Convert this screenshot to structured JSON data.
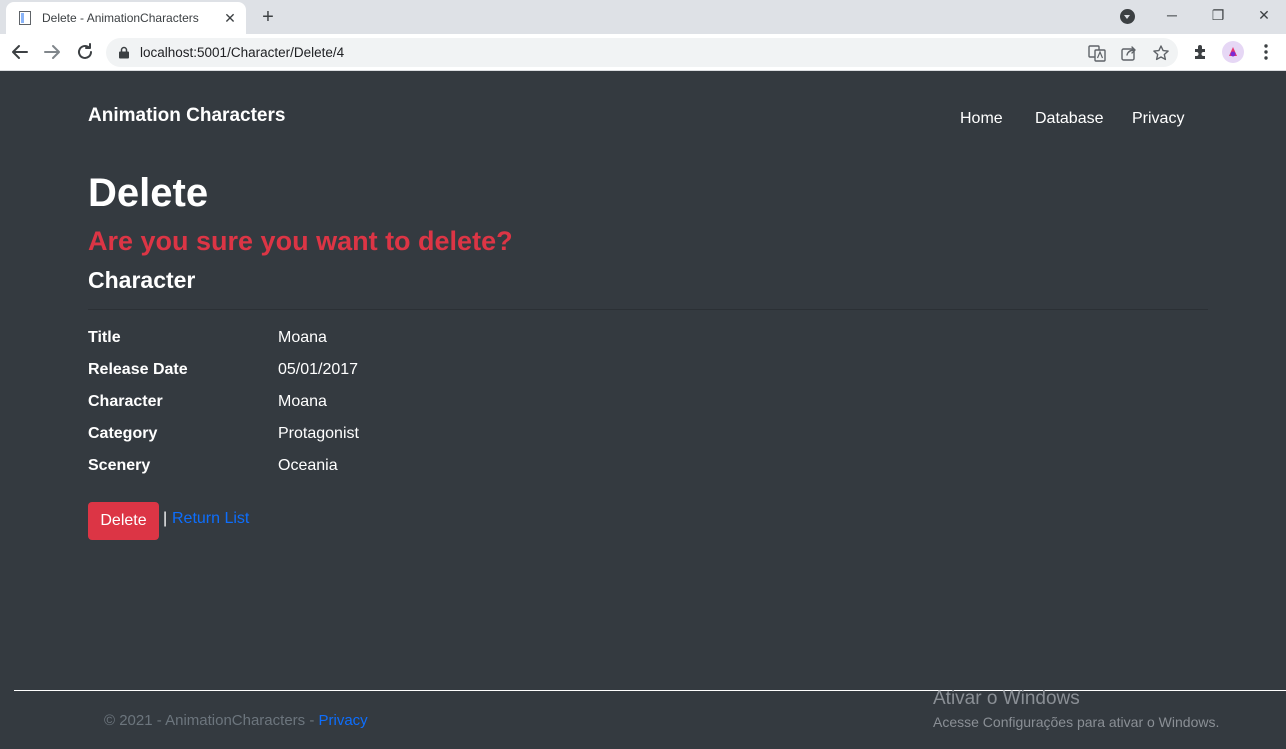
{
  "browser": {
    "tab_title": "Delete - AnimationCharacters",
    "tab_close": "✕",
    "new_tab": "+",
    "url": "localhost:5001/Character/Delete/4",
    "window_minimize": "─",
    "window_restore": "❐",
    "window_close": "✕"
  },
  "nav": {
    "brand": "Animation Characters",
    "links": [
      "Home",
      "Database",
      "Privacy"
    ]
  },
  "main": {
    "title": "Delete",
    "warning": "Are you sure you want to delete?",
    "entity": "Character",
    "details": [
      {
        "label": "Title",
        "value": "Moana"
      },
      {
        "label": "Release Date",
        "value": "05/01/2017"
      },
      {
        "label": "Character",
        "value": "Moana"
      },
      {
        "label": "Category",
        "value": "Protagonist"
      },
      {
        "label": "Scenery",
        "value": "Oceania"
      }
    ],
    "delete_button": "Delete",
    "separator": "|",
    "return_link": "Return List"
  },
  "footer": {
    "copyright": "© 2021 - AnimationCharacters - ",
    "privacy_link": "Privacy"
  },
  "watermark": {
    "title": "Ativar o Windows",
    "subtitle": "Acesse Configurações para ativar o Windows."
  },
  "colors": {
    "page_background": "#343a40",
    "danger": "#dc3545",
    "link": "#0d6efd",
    "footer_text": "#6c757d"
  }
}
